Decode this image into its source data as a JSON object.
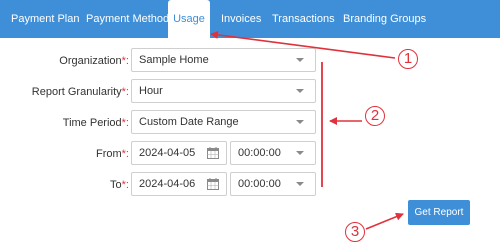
{
  "tabs": [
    {
      "label": "Payment Plan",
      "active": false
    },
    {
      "label": "Payment Method",
      "active": false
    },
    {
      "label": "Usage",
      "active": true
    },
    {
      "label": "Invoices",
      "active": false
    },
    {
      "label": "Transactions",
      "active": false
    },
    {
      "label": "Branding Groups",
      "active": false
    }
  ],
  "form": {
    "organization": {
      "label": "Organization",
      "required_mark": "*:",
      "value": "Sample Home"
    },
    "granularity": {
      "label": "Report Granularity",
      "required_mark": "*:",
      "value": "Hour"
    },
    "period": {
      "label": "Time Period",
      "required_mark": "*:",
      "value": "Custom Date Range"
    },
    "from": {
      "label": "From",
      "required_mark": "*:",
      "date": "2024-04-05",
      "time": "00:00:00"
    },
    "to": {
      "label": "To",
      "required_mark": "*:",
      "date": "2024-04-06",
      "time": "00:00:00"
    }
  },
  "get_report_label": "Get Report",
  "annotations": {
    "one": "1",
    "two": "2",
    "three": "3"
  },
  "colors": {
    "accent": "#3f8fd8",
    "annotation": "#e0323c",
    "required": "#e0323c"
  }
}
